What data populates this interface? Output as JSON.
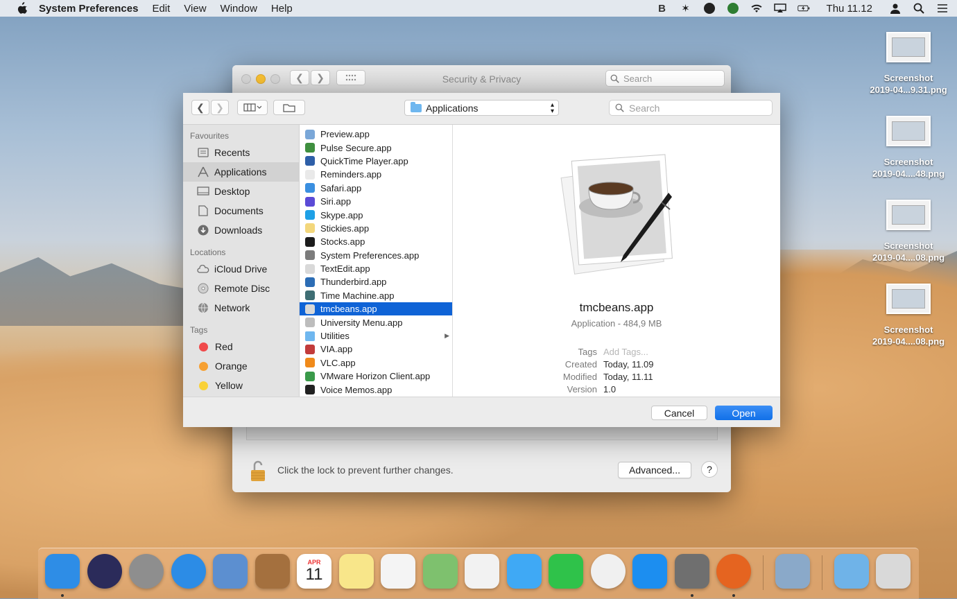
{
  "menubar": {
    "app_name": "System Preferences",
    "menus": [
      "Edit",
      "View",
      "Window",
      "Help"
    ],
    "status_icons": [
      "bluetooth-b-icon",
      "bat-icon",
      "skype-status-icon",
      "sync-icon",
      "wifi-icon",
      "airplay-icon",
      "battery-icon"
    ],
    "clock": "Thu 11.12"
  },
  "desktop": {
    "items": [
      {
        "line1": "Screenshot",
        "line2": "2019-04...9.31.png"
      },
      {
        "line1": "Screenshot",
        "line2": "2019-04....48.png"
      },
      {
        "line1": "Screenshot",
        "line2": "2019-04....08.png"
      },
      {
        "line1": "Screenshot",
        "line2": "2019-04....08.png"
      }
    ]
  },
  "security_window": {
    "title": "Security & Privacy",
    "search_placeholder": "Search",
    "lock_text": "Click the lock to prevent further changes.",
    "advanced_label": "Advanced...",
    "help_label": "?"
  },
  "dialog": {
    "location": "Applications",
    "search_placeholder": "Search",
    "sidebar": {
      "favourites_heading": "Favourites",
      "favourites": [
        {
          "label": "Recents",
          "icon": "recents-icon"
        },
        {
          "label": "Applications",
          "icon": "applications-icon",
          "selected": true
        },
        {
          "label": "Desktop",
          "icon": "desktop-icon"
        },
        {
          "label": "Documents",
          "icon": "documents-icon"
        },
        {
          "label": "Downloads",
          "icon": "downloads-icon"
        }
      ],
      "locations_heading": "Locations",
      "locations": [
        {
          "label": "iCloud Drive",
          "icon": "cloud-icon"
        },
        {
          "label": "Remote Disc",
          "icon": "disc-icon"
        },
        {
          "label": "Network",
          "icon": "globe-icon"
        }
      ],
      "tags_heading": "Tags",
      "tags": [
        {
          "label": "Red",
          "color": "#f0494a"
        },
        {
          "label": "Orange",
          "color": "#f6a033"
        },
        {
          "label": "Yellow",
          "color": "#f9d138"
        }
      ]
    },
    "files": [
      {
        "name": "Preview.app",
        "color": "#7aa7d8"
      },
      {
        "name": "Pulse Secure.app",
        "color": "#3f8f3f"
      },
      {
        "name": "QuickTime Player.app",
        "color": "#2e5fa8"
      },
      {
        "name": "Reminders.app",
        "color": "#e9e9e9"
      },
      {
        "name": "Safari.app",
        "color": "#3a8fe0"
      },
      {
        "name": "Siri.app",
        "color": "#5b4bd6"
      },
      {
        "name": "Skype.app",
        "color": "#1ea0e6"
      },
      {
        "name": "Stickies.app",
        "color": "#f3d77c"
      },
      {
        "name": "Stocks.app",
        "color": "#1c1c1c"
      },
      {
        "name": "System Preferences.app",
        "color": "#7c7c7c"
      },
      {
        "name": "TextEdit.app",
        "color": "#d9d9d9"
      },
      {
        "name": "Thunderbird.app",
        "color": "#2c6db5"
      },
      {
        "name": "Time Machine.app",
        "color": "#3f6e74"
      },
      {
        "name": "tmcbeans.app",
        "color": "#d8d8d8",
        "selected": true
      },
      {
        "name": "University Menu.app",
        "color": "#bdbdbd"
      },
      {
        "name": "Utilities",
        "color": "#6fb7ef",
        "folder": true
      },
      {
        "name": "VIA.app",
        "color": "#c23b3b"
      },
      {
        "name": "VLC.app",
        "color": "#f08a1a"
      },
      {
        "name": "VMware Horizon Client.app",
        "color": "#3a9a4a"
      },
      {
        "name": "Voice Memos.app",
        "color": "#222222"
      }
    ],
    "preview": {
      "name": "tmcbeans.app",
      "kind": "Application - 484,9 MB",
      "tags_label": "Tags",
      "tags_value": "Add Tags...",
      "created_label": "Created",
      "created_value": "Today, 11.09",
      "modified_label": "Modified",
      "modified_value": "Today, 11.11",
      "version_label": "Version",
      "version_value": "1.0"
    },
    "cancel_label": "Cancel",
    "open_label": "Open"
  },
  "dock": {
    "apps": [
      {
        "name": "finder-icon",
        "color": "#2e8de6",
        "running": true
      },
      {
        "name": "siri-icon",
        "color": "#2b2b5a"
      },
      {
        "name": "launchpad-icon",
        "color": "#8e8e8e"
      },
      {
        "name": "safari-icon",
        "color": "#2c8ce6"
      },
      {
        "name": "mail-icon",
        "color": "#5c8fd0"
      },
      {
        "name": "contacts-icon",
        "color": "#a4703e"
      },
      {
        "name": "calendar-icon",
        "color": "#ffffff"
      },
      {
        "name": "notes-icon",
        "color": "#f8e68a"
      },
      {
        "name": "reminders-icon",
        "color": "#f4f4f4"
      },
      {
        "name": "maps-icon",
        "color": "#7ec16e"
      },
      {
        "name": "photos-icon",
        "color": "#f2f2f2"
      },
      {
        "name": "messages-icon",
        "color": "#3fa9f5"
      },
      {
        "name": "facetime-icon",
        "color": "#2fc24a"
      },
      {
        "name": "itunes-icon",
        "color": "#f0f0f0"
      },
      {
        "name": "app-store-icon",
        "color": "#1c8ef0"
      },
      {
        "name": "system-preferences-icon",
        "color": "#6f6f6f",
        "running": true
      },
      {
        "name": "firefox-icon",
        "color": "#e56420",
        "running": true
      }
    ],
    "right": [
      {
        "name": "preview-icon",
        "color": "#8aa9c9"
      },
      {
        "name": "downloads-folder-icon",
        "color": "#6fb3e8"
      },
      {
        "name": "trash-icon",
        "color": "#d9d9d9"
      }
    ],
    "calendar_month": "APR",
    "calendar_day": "11"
  }
}
